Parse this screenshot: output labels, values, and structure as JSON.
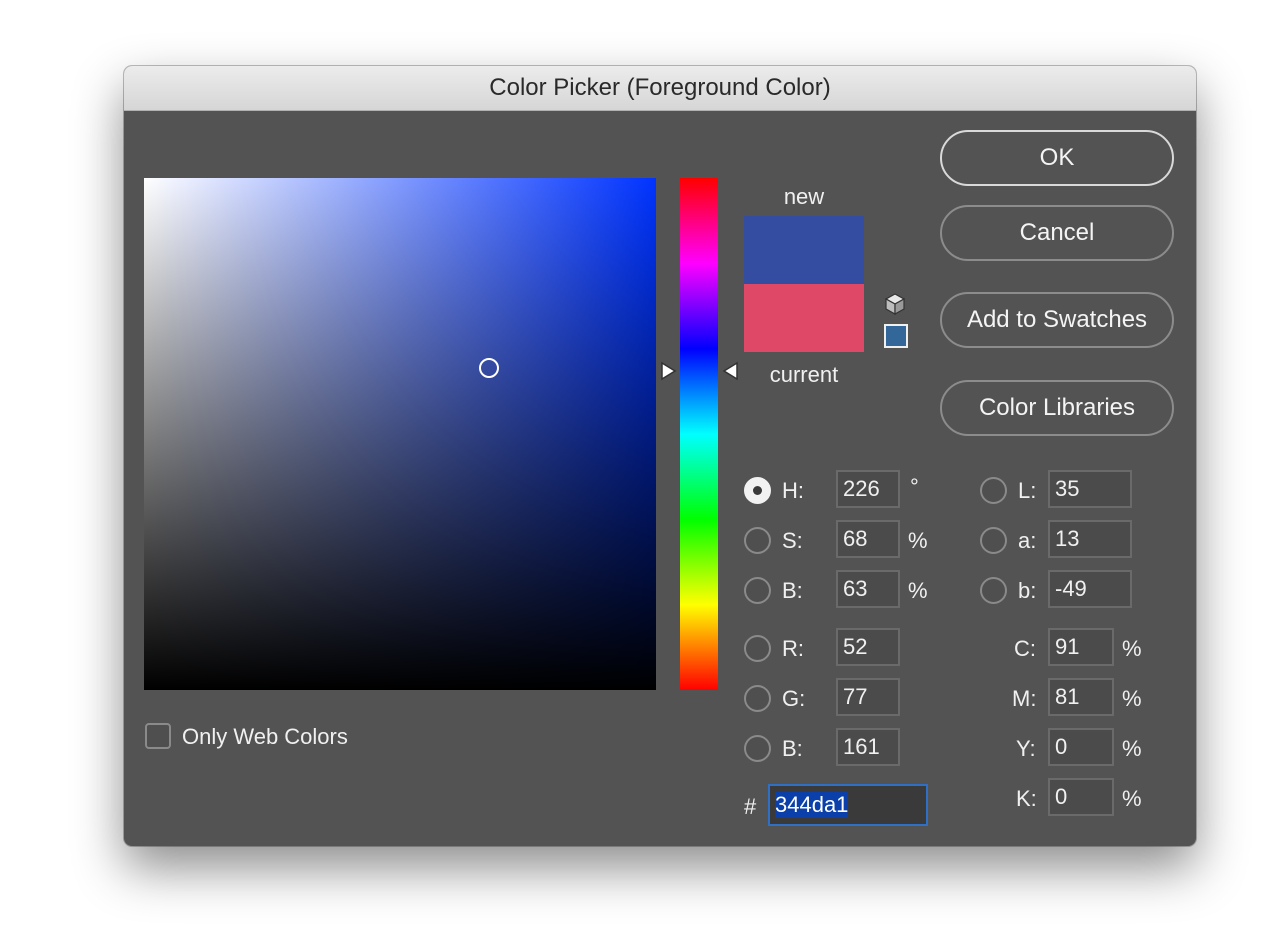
{
  "window": {
    "title": "Color Picker (Foreground Color)"
  },
  "colors": {
    "new": "#344da1",
    "current": "#e04868",
    "hue_base": "#0033ff"
  },
  "preview": {
    "new_label": "new",
    "current_label": "current"
  },
  "buttons": {
    "ok": "OK",
    "cancel": "Cancel",
    "add_to_swatches": "Add to Swatches",
    "color_libraries": "Color Libraries"
  },
  "options": {
    "only_web_colors": "Only Web Colors",
    "only_web_colors_checked": false
  },
  "hsb": {
    "h": {
      "label": "H:",
      "value": "226",
      "unit": "°",
      "selected": true
    },
    "s": {
      "label": "S:",
      "value": "68",
      "unit": "%",
      "selected": false
    },
    "b": {
      "label": "B:",
      "value": "63",
      "unit": "%",
      "selected": false
    }
  },
  "rgb": {
    "r": {
      "label": "R:",
      "value": "52"
    },
    "g": {
      "label": "G:",
      "value": "77"
    },
    "b": {
      "label": "B:",
      "value": "161"
    }
  },
  "lab": {
    "l": {
      "label": "L:",
      "value": "35"
    },
    "a": {
      "label": "a:",
      "value": "13"
    },
    "b": {
      "label": "b:",
      "value": "-49"
    }
  },
  "cmyk": {
    "c": {
      "label": "C:",
      "value": "91",
      "unit": "%"
    },
    "m": {
      "label": "M:",
      "value": "81",
      "unit": "%"
    },
    "y": {
      "label": "Y:",
      "value": "0",
      "unit": "%"
    },
    "k": {
      "label": "K:",
      "value": "0",
      "unit": "%"
    }
  },
  "hex": {
    "label": "#",
    "value": "344da1"
  },
  "icons": {
    "gamut_cube": "cube-icon",
    "web_safe_swatch": "swatch-icon"
  }
}
